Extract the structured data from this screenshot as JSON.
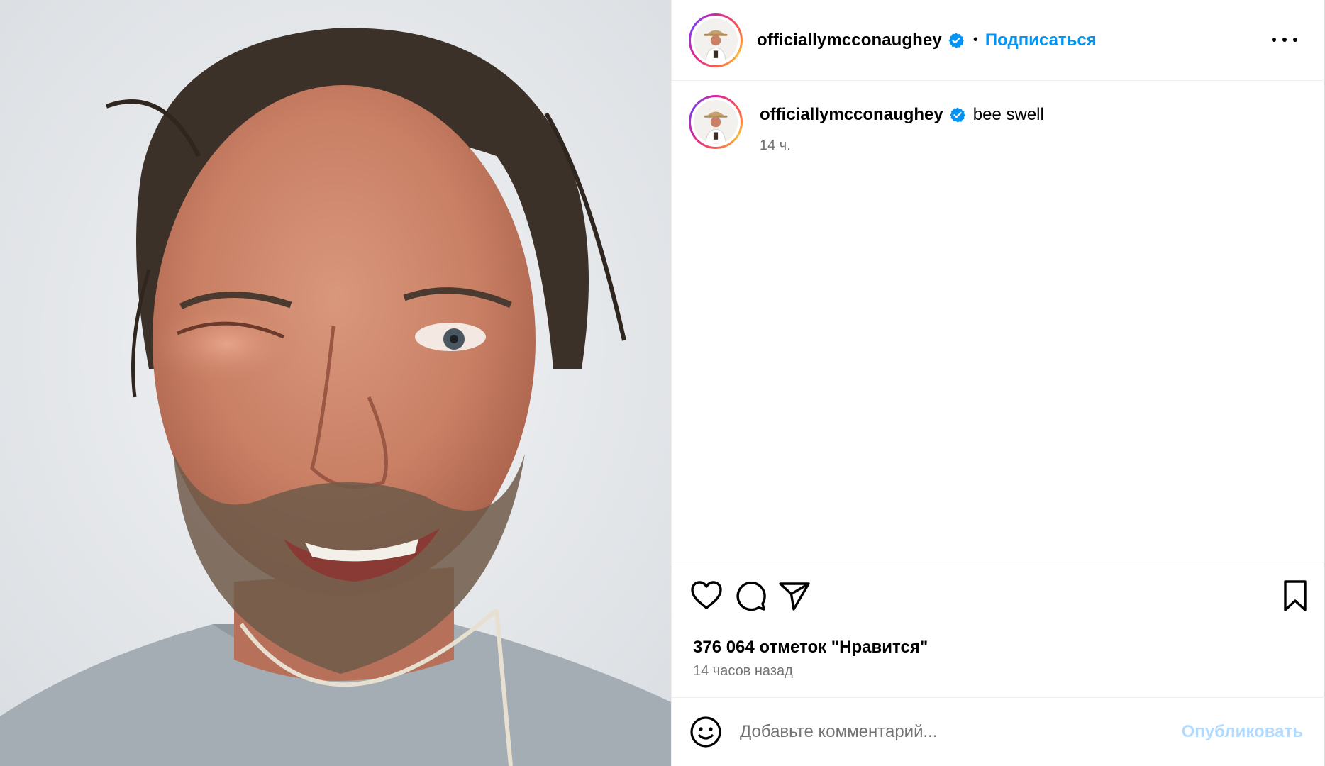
{
  "post": {
    "image_alt": "Man with swollen eye smiling",
    "header": {
      "username": "officiallymcconaughey",
      "separator": "•",
      "follow_label": "Подписаться"
    },
    "caption": {
      "username": "officiallymcconaughey",
      "text": "bee swell",
      "time": "14 ч."
    },
    "likes_text": "376 064 отметок \"Нравится\"",
    "time_ago": "14 часов назад",
    "comment": {
      "placeholder": "Добавьте комментарий...",
      "publish_label": "Опубликовать"
    }
  },
  "icons": {
    "verified": "verified-badge-icon",
    "like": "heart-icon",
    "comment": "comment-bubble-icon",
    "share": "send-icon",
    "save": "bookmark-icon",
    "emoji": "emoji-icon",
    "more": "more-options-icon"
  },
  "colors": {
    "accent": "#0095f6",
    "publish_disabled": "#b3dbff",
    "muted_text": "#737373",
    "verified": "#0095f6"
  }
}
